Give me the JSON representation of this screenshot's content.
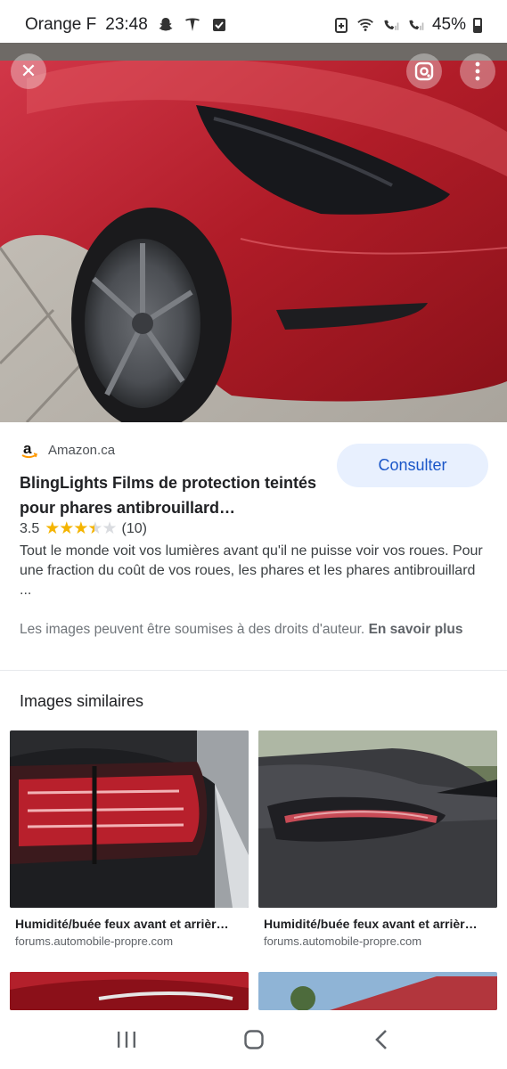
{
  "status": {
    "carrier": "Orange F",
    "time": "23:48",
    "battery": "45%",
    "battery_level": 0.45
  },
  "hero": {
    "close_icon": "close-icon",
    "lens_icon": "lens-icon",
    "more_icon": "more-vert-icon"
  },
  "result": {
    "source": "Amazon.ca",
    "title": "BlingLights Films de protection teintés pour phares antibrouillard…",
    "rating_value": "3.5",
    "rating": 3.5,
    "review_count": "(10)",
    "description": "Tout le monde voit vos lumières avant qu'il ne puisse voir vos roues. Pour une fraction du coût de vos roues, les phares et les phares antibrouillard ...",
    "copyright_text": "Les images peuvent être soumises à des droits d'auteur.",
    "learn_more": "En savoir plus",
    "consult_button": "Consulter"
  },
  "similar": {
    "heading": "Images similaires",
    "items": [
      {
        "title": "Humidité/buée feux avant et arrièr…",
        "source": "forums.automobile-propre.com"
      },
      {
        "title": "Humidité/buée feux avant et arrièr…",
        "source": "forums.automobile-propre.com"
      }
    ]
  },
  "colors": {
    "accent": "#1a56c8",
    "button_bg": "#e8f0fe",
    "star": "#f4b400",
    "car_red": "#b4202a"
  }
}
